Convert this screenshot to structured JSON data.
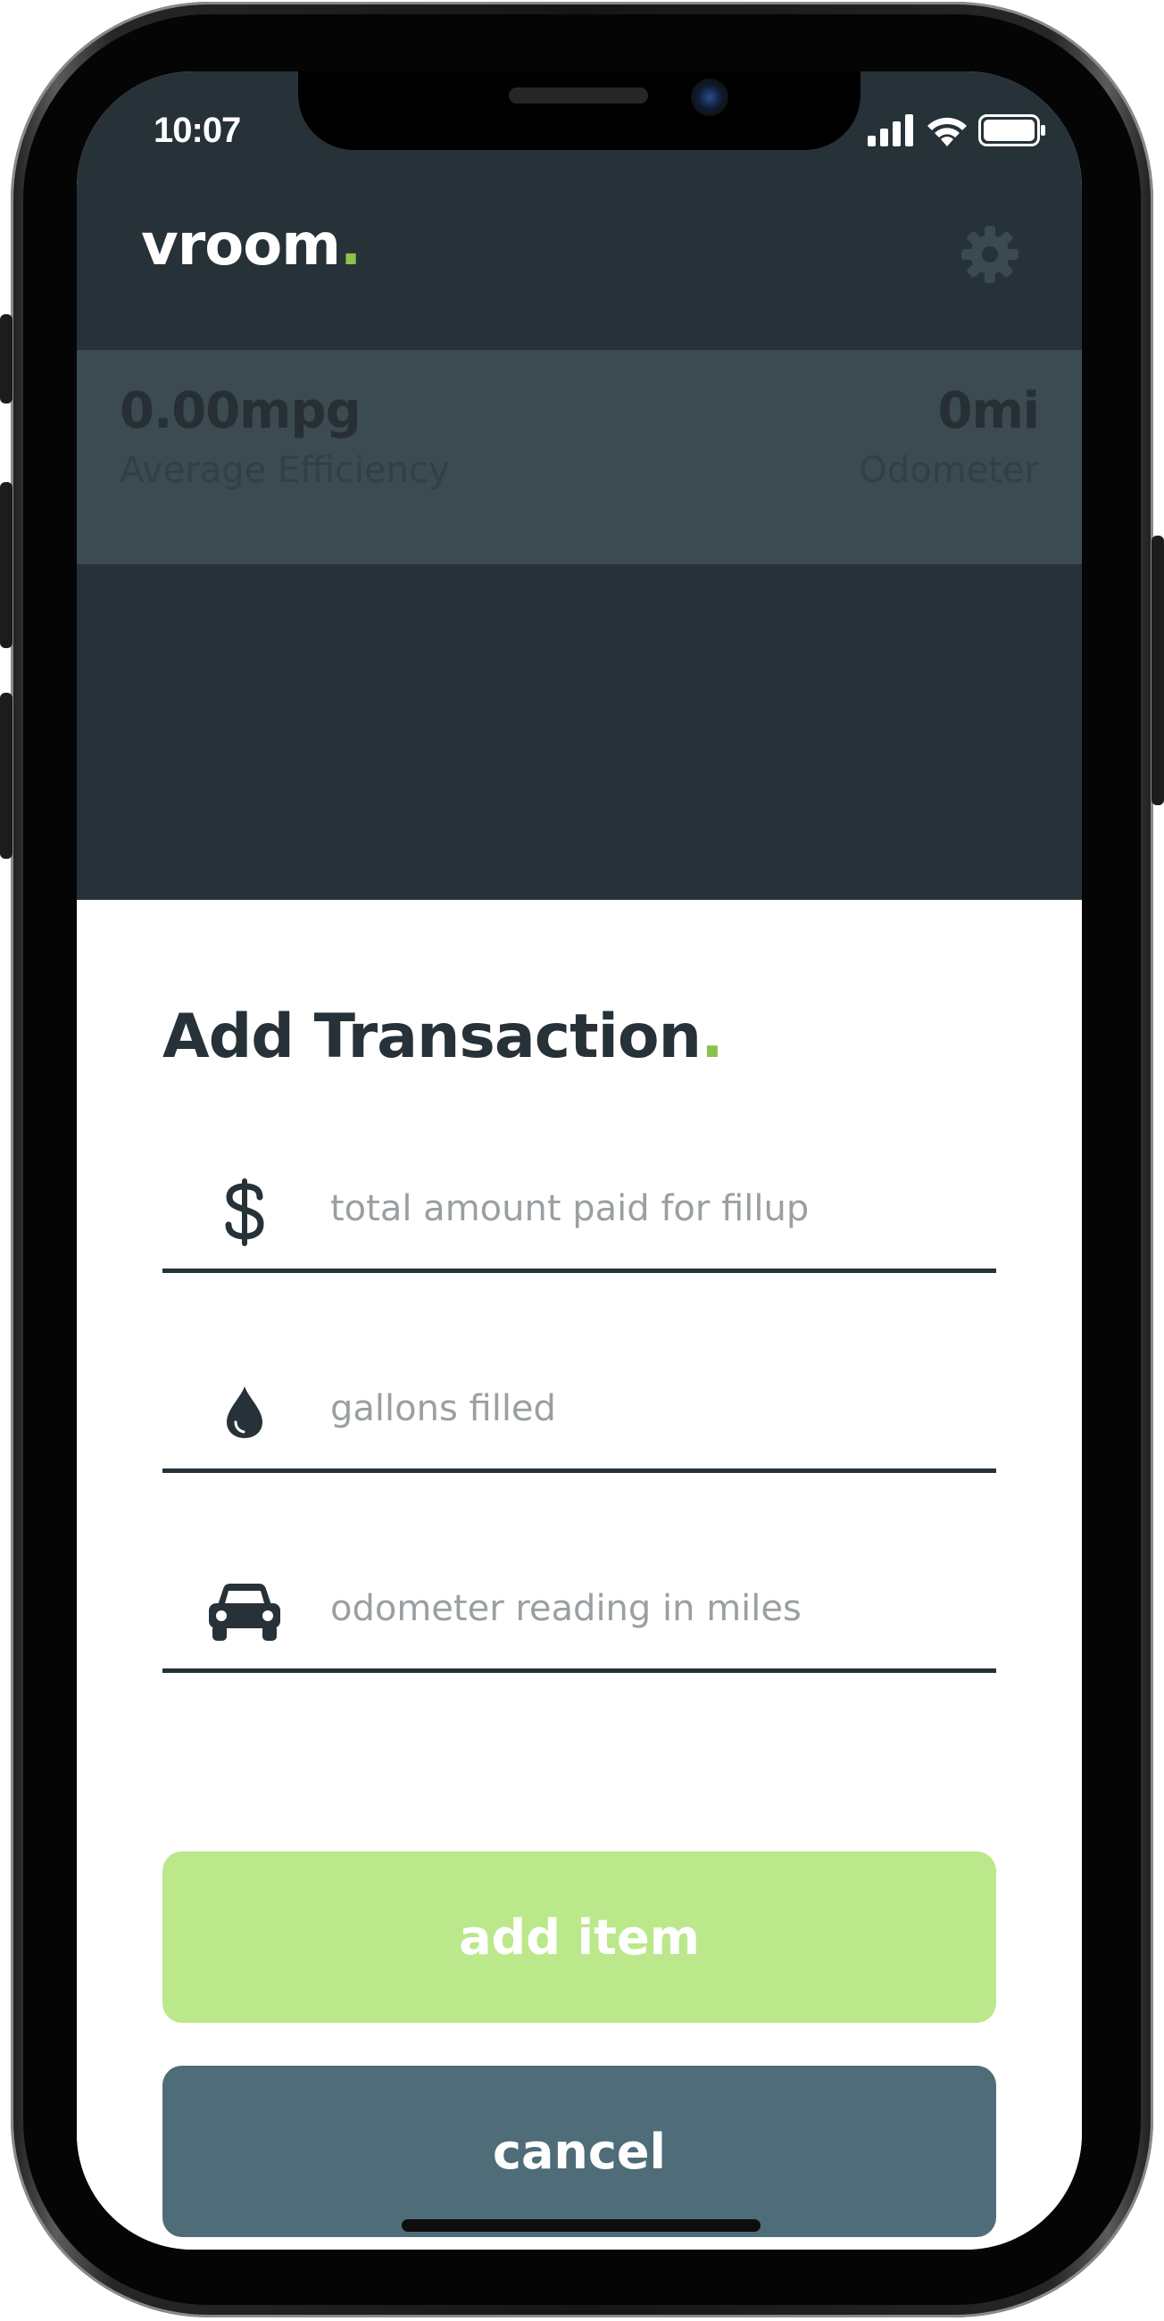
{
  "status_bar": {
    "time": "10:07"
  },
  "header": {
    "logo_text": "vroom",
    "logo_dot": "."
  },
  "stats": {
    "efficiency_value": "0.00mpg",
    "efficiency_label": "Average Efficiency",
    "odometer_value": "0mi",
    "odometer_label": "Odometer"
  },
  "modal": {
    "title": "Add Transaction",
    "title_dot": ".",
    "fields": [
      {
        "icon": "dollar-icon",
        "placeholder": "total amount paid for fillup",
        "value": ""
      },
      {
        "icon": "drop-icon",
        "placeholder": "gallons filled",
        "value": ""
      },
      {
        "icon": "car-icon",
        "placeholder": "odometer reading in miles",
        "value": ""
      }
    ],
    "add_button_label": "add item",
    "cancel_button_label": "cancel"
  },
  "colors": {
    "header_bg": "#263237",
    "stats_bg": "#3c4a51",
    "accent": "#8bc34a",
    "add_button": "#bbe88a",
    "cancel_button": "#4f6c79",
    "text_dark": "#263237",
    "placeholder": "#9a9fa2"
  }
}
